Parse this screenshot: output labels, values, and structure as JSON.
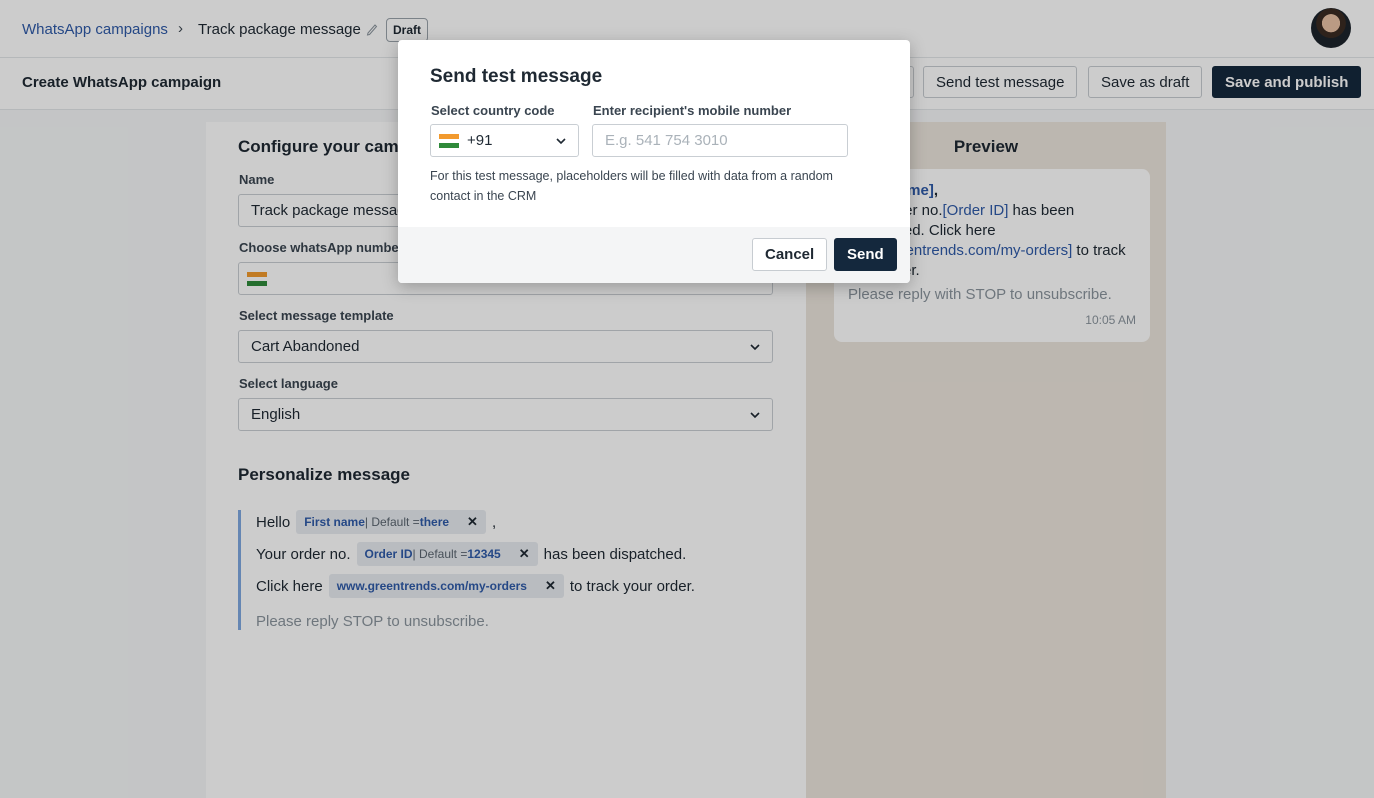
{
  "header": {
    "breadcrumb_root": "WhatsApp campaigns",
    "breadcrumb_separator": "›",
    "campaign_name": "Track package message",
    "status_badge": "Draft"
  },
  "subheader": {
    "title": "Create WhatsApp campaign",
    "send_test_label": "Send test message",
    "save_draft_label": "Save as draft",
    "publish_label": "Save and publish"
  },
  "configure": {
    "title": "Configure your campaign",
    "name_label": "Name",
    "name_value": "Track package message",
    "whatsapp_label": "Choose whatsApp number",
    "template_label": "Select message template",
    "template_value": "Cart Abandoned",
    "language_label": "Select language",
    "language_value": "English"
  },
  "personalize": {
    "title": "Personalize message",
    "line1_prefix": "Hello",
    "chip1_key": "First name",
    "chip1_mid": " | Default = ",
    "chip1_value": "there",
    "line1_suffix": ",",
    "line2_prefix": "Your order no.",
    "chip2_key": "Order ID",
    "chip2_mid": " | Default = ",
    "chip2_value": "12345",
    "line2_suffix": "has been dispatched.",
    "line3_prefix": "Click here",
    "chip3_key": "www.greentrends.com/my-orders",
    "line3_suffix": "to track your order.",
    "footer": "Please reply STOP to unsubscribe.",
    "chip_remove": "✕"
  },
  "preview": {
    "title": "Preview",
    "line1_ph": "[First name]",
    "line1_after": ",",
    "line2_before": "Your order no.",
    "line2_ph": "[Order ID]",
    "line2_after": " has been dispatched. Click here ",
    "line3_ph": "www.greentrends.com/my-orders]",
    "line3_after": " to track your order.",
    "footer": "Please reply with STOP to unsubscribe.",
    "time": "10:05 AM"
  },
  "modal": {
    "title": "Send test message",
    "country_label": "Select country code",
    "country_value": "+91",
    "phone_label": "Enter recipient's mobile number",
    "phone_placeholder": "E.g. 541 754 3010",
    "phone_value": "",
    "hint": "For this test message, placeholders will be filled with data from a random contact in the CRM",
    "cancel_label": "Cancel",
    "send_label": "Send"
  },
  "colors": {
    "accent_dark": "#14283d",
    "link_blue": "#2f5aa8",
    "preview_bg": "#ece5dc"
  },
  "icons": [
    "chevron-right-icon",
    "pencil-icon",
    "chevron-down-icon",
    "india-flag-icon",
    "close-icon"
  ]
}
